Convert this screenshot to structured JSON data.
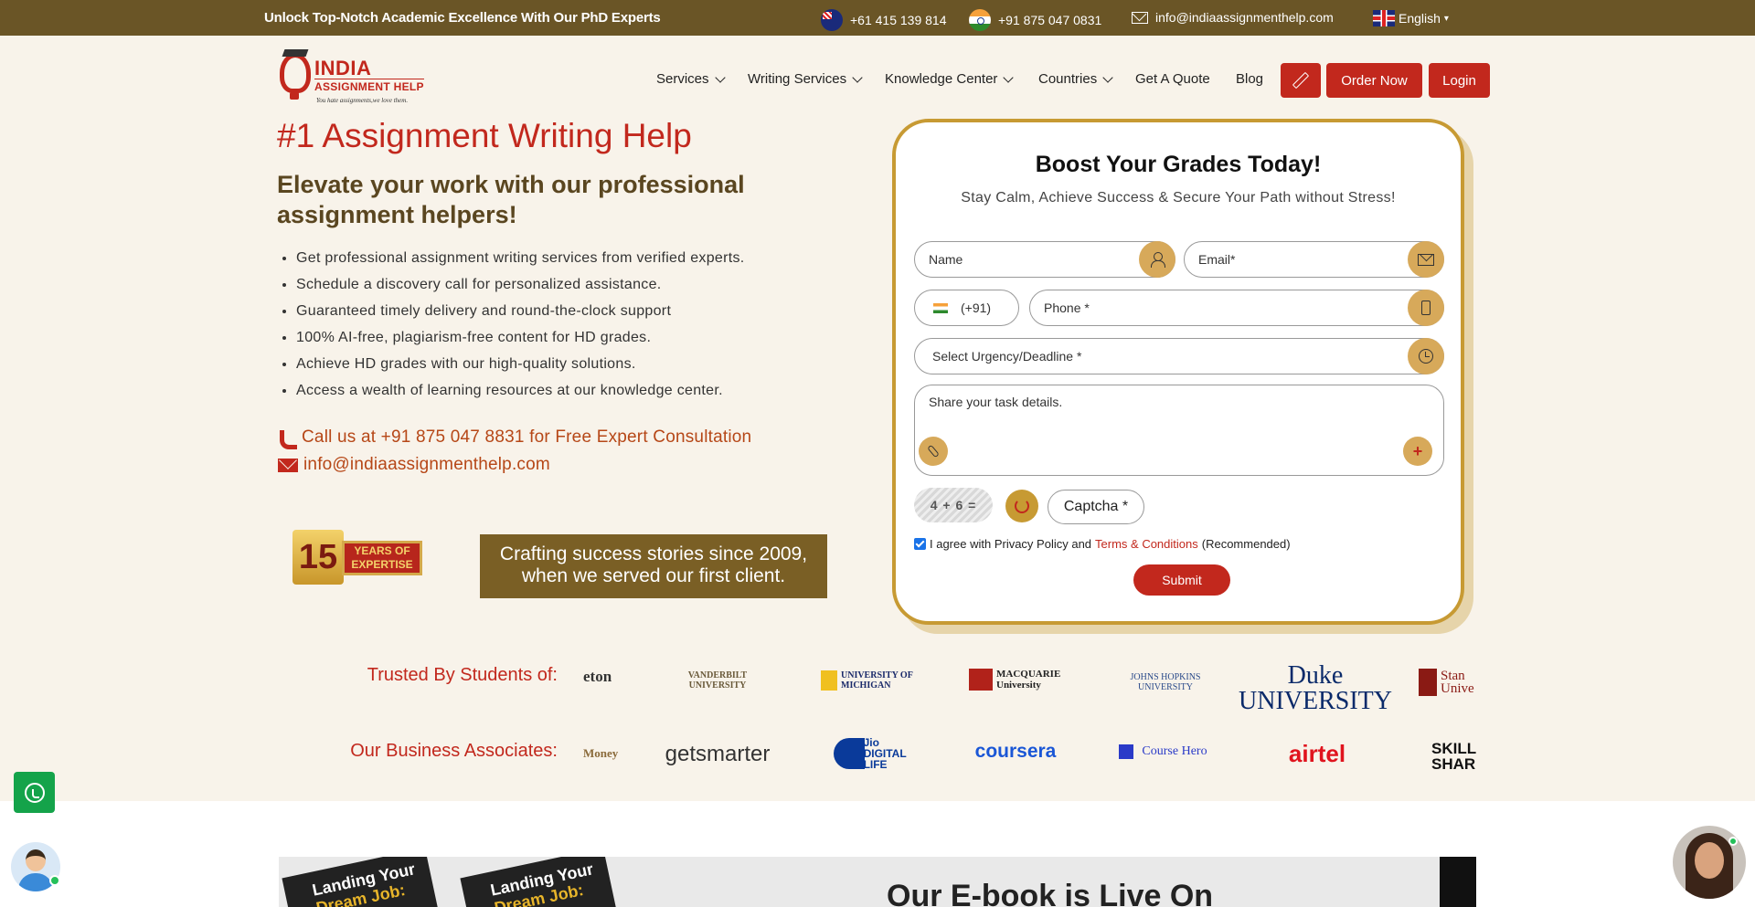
{
  "topbar": {
    "tagline": "Unlock Top-Notch Academic Excellence With Our PhD Experts",
    "phone_au": "+61 415 139 814",
    "phone_in": "+91 875 047 0831",
    "email": "info@indiaassignmenthelp.com",
    "language": "English",
    "language_caret": "▾"
  },
  "logo": {
    "line1": "INDIA",
    "line2": "ASSIGNMENT HELP",
    "tagline": "You hate assignments,we love them."
  },
  "nav": {
    "services": "Services",
    "writing_services": "Writing Services",
    "knowledge_center": "Knowledge Center",
    "countries": "Countries",
    "get_a_quote": "Get A Quote",
    "blog": "Blog",
    "order_now": "Order Now",
    "login": "Login"
  },
  "hero": {
    "title": "#1 Assignment Writing Help",
    "subtitle": "Elevate your work with our professional assignment helpers!",
    "bullets": [
      "Get professional assignment writing services from verified experts.",
      "Schedule a discovery call for personalized assistance.",
      "Guaranteed timely delivery and round-the-clock support",
      "100% AI-free, plagiarism-free content for HD grades.",
      "Achieve HD grades with our high-quality solutions.",
      "Access a wealth of learning resources at our knowledge center."
    ],
    "call_text": "Call us at +91 875 047 8831 for Free Expert Consultation",
    "email_text": "info@indiaassignmenthelp.com",
    "badge_number": "15",
    "badge_text_1": "YEARS OF",
    "badge_text_2": "EXPERTISE",
    "since_text": "Crafting success stories since 2009, when we served our first client."
  },
  "form": {
    "title": "Boost Your Grades Today!",
    "subtitle": "Stay Calm, Achieve Success & Secure Your Path without Stress!",
    "name_placeholder": "Name",
    "email_placeholder": "Email*",
    "country_code": "(+91)",
    "phone_placeholder": "Phone *",
    "urgency_placeholder": "Select Urgency/Deadline *",
    "task_placeholder": "Share your task details.",
    "add_symbol": "+",
    "captcha_text": "4 + 6 =",
    "captcha_placeholder": "Captcha *",
    "agree_text": "I agree with Privacy Policy and",
    "terms_text": "Terms & Conditions",
    "recommended_text": "(Recommended)",
    "submit_label": "Submit"
  },
  "trusted": {
    "label": "Trusted By Students of:",
    "logos": [
      "eton",
      "VANDERBILT UNIVERSITY",
      "UNIVERSITY OF MICHIGAN",
      "MACQUARIE University",
      "JOHNS HOPKINS UNIVERSITY",
      "Duke UNIVERSITY",
      "Stan Unive"
    ]
  },
  "associates": {
    "label": "Our Business Associates:",
    "logos": [
      "Money",
      "getsmarter",
      "Jio DIGITAL LIFE",
      "coursera",
      "Course Hero",
      "airtel",
      "SKILL SHAR"
    ]
  },
  "ebook": {
    "book_line1": "Landing Your",
    "book_line2": "Dream Job:",
    "heading": "Our E-book is Live On"
  },
  "colors": {
    "topbar": "#6a5526",
    "accent_red": "#c2281d",
    "hero_bg": "#f8f3ea",
    "gold": "#c79a33"
  }
}
